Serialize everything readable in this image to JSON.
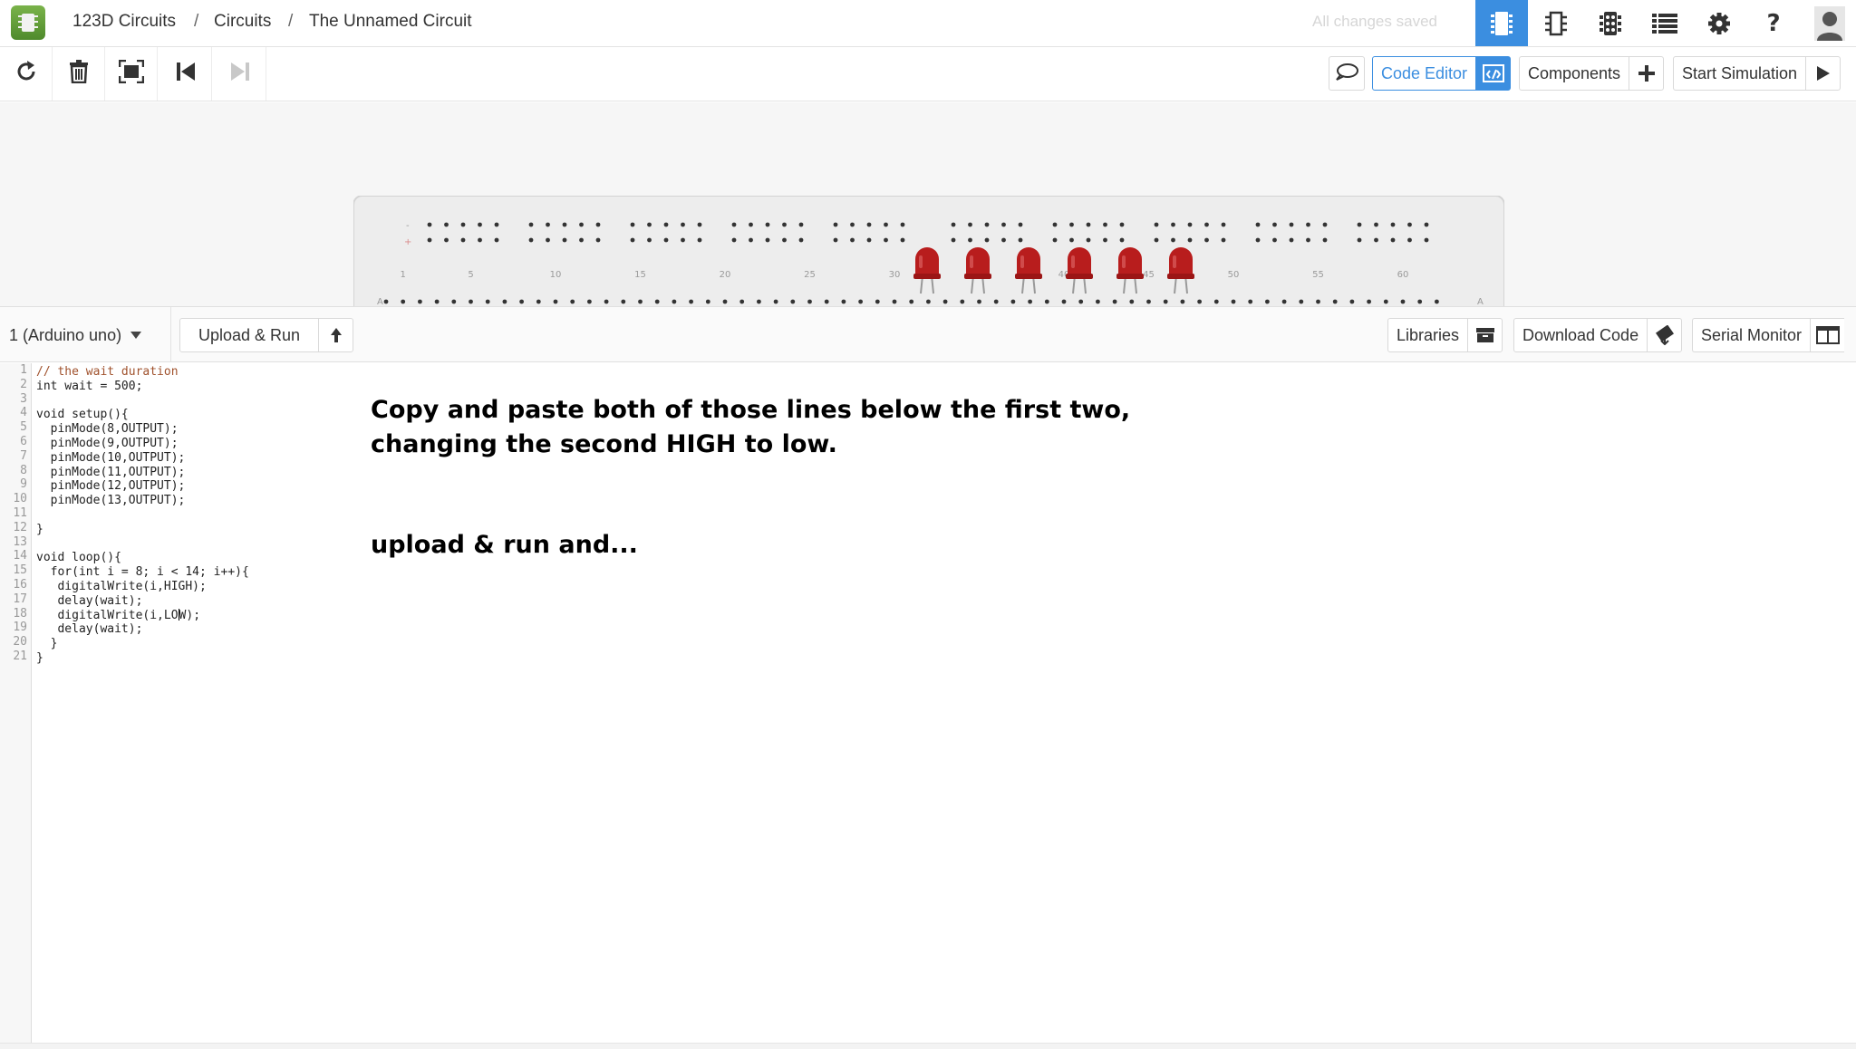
{
  "app": {
    "breadcrumb": [
      "123D Circuits",
      "Circuits",
      "The Unnamed Circuit"
    ],
    "breadcrumb_separator": "/",
    "save_status": "All changes saved"
  },
  "colors": {
    "accent": "#3b8ee0",
    "led_red": "#b81d1d",
    "breadboard": "#eeeeee",
    "code_comment": "#a0522d"
  },
  "topbar_icons": [
    "breadboard-view-icon",
    "schematic-view-icon",
    "pcb-view-icon",
    "list-view-icon",
    "gear-icon",
    "help-icon",
    "avatar-icon"
  ],
  "toolbar": {
    "tools": [
      "rotate-icon",
      "trash-icon",
      "fit-screen-icon",
      "step-back-icon",
      "step-forward-icon"
    ],
    "code_editor_label": "Code Editor",
    "components_label": "Components",
    "start_simulation_label": "Start Simulation"
  },
  "breadboard": {
    "column_labels": [
      "1",
      "5",
      "10",
      "15",
      "20",
      "25",
      "30",
      "35",
      "40",
      "45",
      "50",
      "55",
      "60"
    ],
    "row_labels": {
      "minus": "-",
      "plus": "+",
      "row_a": "A"
    },
    "led_count": 6
  },
  "editor_bar": {
    "board": "1 (Arduino uno)",
    "upload_run": "Upload & Run",
    "libraries": "Libraries",
    "download_code": "Download Code",
    "serial_monitor": "Serial Monitor"
  },
  "code": {
    "line_numbers": [
      "1",
      "2",
      "3",
      "4",
      "5",
      "6",
      "7",
      "8",
      "9",
      "10",
      "11",
      "12",
      "13",
      "14",
      "15",
      "16",
      "17",
      "18",
      "19",
      "20",
      "21"
    ],
    "lines": [
      "// the wait duration",
      "int wait = 500;",
      "",
      "void setup(){",
      "  pinMode(8,OUTPUT);",
      "  pinMode(9,OUTPUT);",
      "  pinMode(10,OUTPUT);",
      "  pinMode(11,OUTPUT);",
      "  pinMode(12,OUTPUT);",
      "  pinMode(13,OUTPUT);",
      "",
      "}",
      "",
      "void loop(){",
      "  for(int i = 8; i < 14; i++){",
      "   digitalWrite(i,HIGH);",
      "   delay(wait);",
      "   digitalWrite(i,LOW);",
      "   delay(wait);",
      "  }",
      "}"
    ],
    "cursor_line": 18,
    "cursor_column": 20
  },
  "overlay": {
    "line1": "Copy and paste both of those lines below the first two,",
    "line2": "changing the second HIGH to low.",
    "line3": "upload & run and..."
  }
}
